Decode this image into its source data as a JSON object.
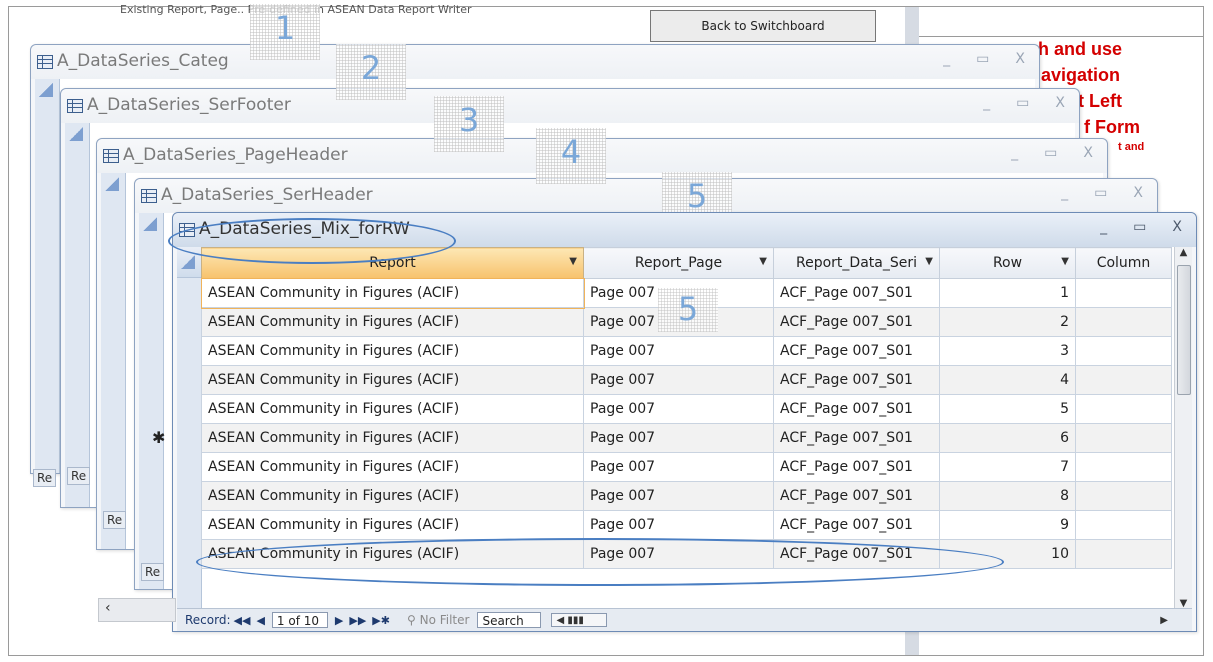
{
  "background": {
    "top_text": "Existing Report, Page.. Pre-defined in ASEAN Data Report Writer",
    "switchboard_button": "Back to Switchboard",
    "instructions": {
      "line1": "ch and use",
      "line2": "Navigation",
      "line3": "at Left",
      "line4": "f Form",
      "line5": "t and"
    }
  },
  "windows": [
    {
      "title": "A_DataSeries_Categ"
    },
    {
      "title": "A_DataSeries_SerFooter"
    },
    {
      "title": "A_DataSeries_PageHeader"
    },
    {
      "title": "A_DataSeries_SerHeader"
    }
  ],
  "window_buttons": {
    "minimize": "_",
    "maximize": "▭",
    "close": "X"
  },
  "record_tab_label": "Re",
  "new_row_marker": "✱",
  "numbers": [
    "1",
    "2",
    "3",
    "4",
    "5"
  ],
  "active": {
    "title": "A_DataSeries_Mix_forRW",
    "columns": [
      "Report",
      "Report_Page",
      "Report_Data_Seri",
      "Row",
      "Column"
    ],
    "rows": [
      {
        "report": "ASEAN Community in Figures (ACIF)",
        "page": "Page 007",
        "series": "ACF_Page 007_S01",
        "row": "1"
      },
      {
        "report": "ASEAN Community in Figures (ACIF)",
        "page": "Page 007",
        "series": "ACF_Page 007_S01",
        "row": "2"
      },
      {
        "report": "ASEAN Community in Figures (ACIF)",
        "page": "Page 007",
        "series": "ACF_Page 007_S01",
        "row": "3"
      },
      {
        "report": "ASEAN Community in Figures (ACIF)",
        "page": "Page 007",
        "series": "ACF_Page 007_S01",
        "row": "4"
      },
      {
        "report": "ASEAN Community in Figures (ACIF)",
        "page": "Page 007",
        "series": "ACF_Page 007_S01",
        "row": "5"
      },
      {
        "report": "ASEAN Community in Figures (ACIF)",
        "page": "Page 007",
        "series": "ACF_Page 007_S01",
        "row": "6"
      },
      {
        "report": "ASEAN Community in Figures (ACIF)",
        "page": "Page 007",
        "series": "ACF_Page 007_S01",
        "row": "7"
      },
      {
        "report": "ASEAN Community in Figures (ACIF)",
        "page": "Page 007",
        "series": "ACF_Page 007_S01",
        "row": "8"
      },
      {
        "report": "ASEAN Community in Figures (ACIF)",
        "page": "Page 007",
        "series": "ACF_Page 007_S01",
        "row": "9"
      },
      {
        "report": "ASEAN Community in Figures (ACIF)",
        "page": "Page 007",
        "series": "ACF_Page 007_S01",
        "row": "10"
      }
    ],
    "nav": {
      "label": "Record:",
      "first": "◀◀",
      "prev": "◀",
      "current": "1 of 10",
      "next": "▶",
      "last": "▶▶",
      "new": "▶✱",
      "no_filter": "No Filter",
      "search": "Search"
    }
  }
}
